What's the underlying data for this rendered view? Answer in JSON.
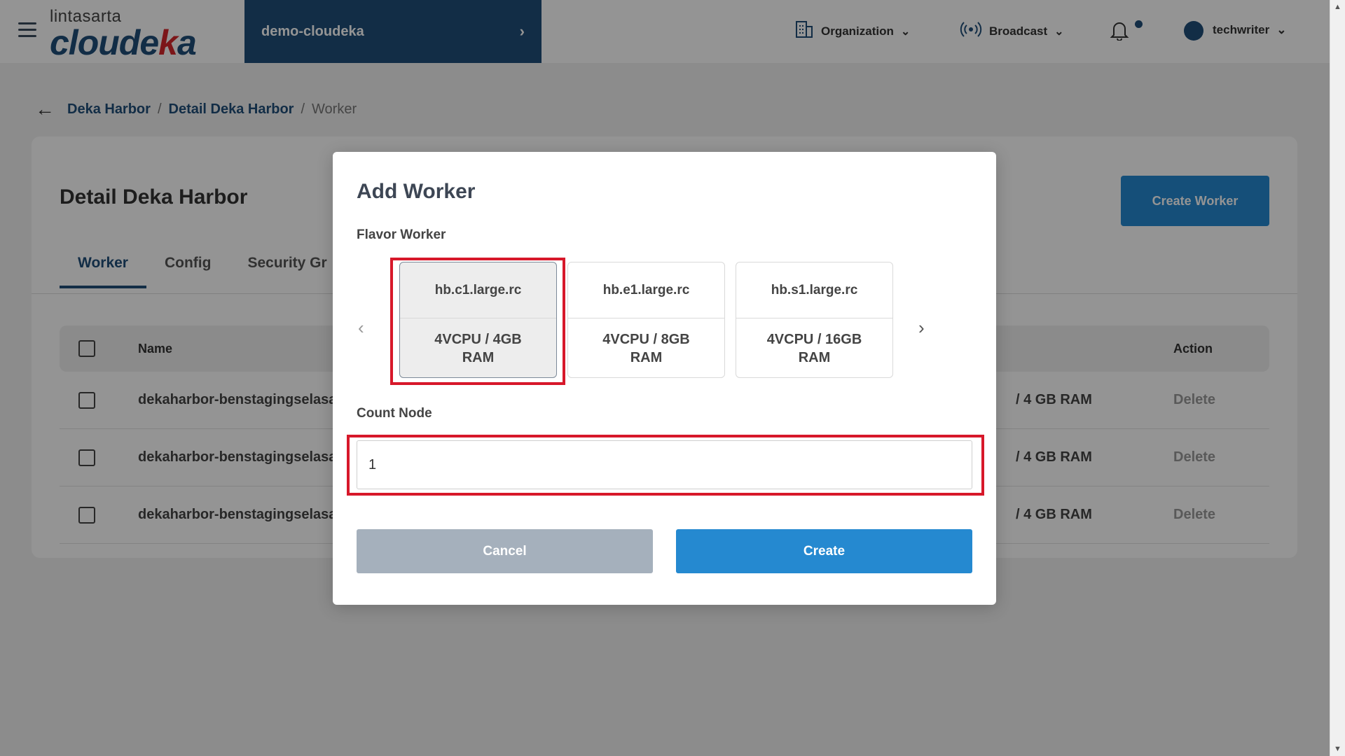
{
  "header": {
    "logo_top": "lintasarta",
    "logo_main_part1": "cloude",
    "logo_main_k": "k",
    "logo_main_part2": "a",
    "project": "demo-cloudeka",
    "nav": [
      {
        "label": "Organization"
      },
      {
        "label": "Broadcast"
      }
    ],
    "user": "techwriter"
  },
  "breadcrumb": {
    "items": [
      "Deka Harbor",
      "Detail Deka Harbor",
      "Worker"
    ],
    "separator": "/"
  },
  "page": {
    "title": "Detail Deka Harbor",
    "create_button": "Create Worker",
    "tabs": [
      "Worker",
      "Config",
      "Security Gr"
    ],
    "table": {
      "headers": {
        "name": "Name",
        "action": "Action"
      },
      "rows": [
        {
          "name": "dekaharbor-benstagingselasa0",
          "spec": "/ 4 GB RAM",
          "action": "Delete"
        },
        {
          "name": "dekaharbor-benstagingselasa0",
          "spec": "/ 4 GB RAM",
          "action": "Delete"
        },
        {
          "name": "dekaharbor-benstagingselasa0",
          "spec": "/ 4 GB RAM",
          "action": "Delete"
        }
      ]
    }
  },
  "modal": {
    "title": "Add Worker",
    "flavor_label": "Flavor Worker",
    "flavors": [
      {
        "name": "hb.c1.large.rc",
        "spec": "4VCPU / 4GB RAM",
        "selected": true
      },
      {
        "name": "hb.e1.large.rc",
        "spec": "4VCPU / 8GB RAM",
        "selected": false
      },
      {
        "name": "hb.s1.large.rc",
        "spec": "4VCPU / 16GB RAM",
        "selected": false
      }
    ],
    "count_label": "Count Node",
    "count_value": "1",
    "cancel_label": "Cancel",
    "create_label": "Create"
  },
  "colors": {
    "brand_dark": "#1f4e79",
    "primary_button": "#2589d0",
    "highlight": "#d7182a"
  }
}
